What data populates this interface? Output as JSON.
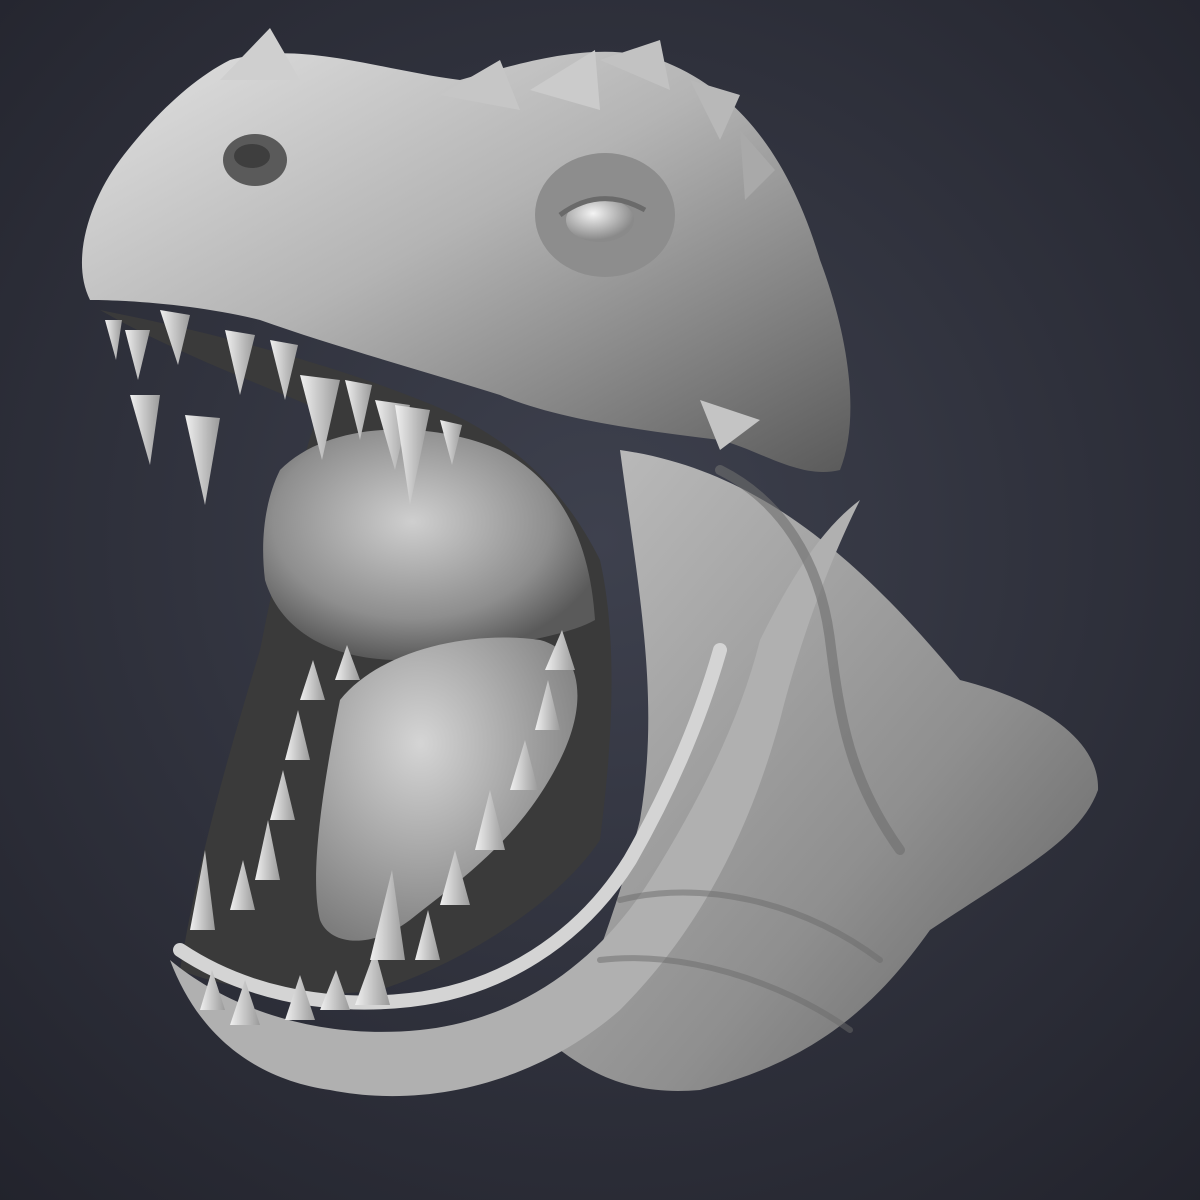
{
  "scene": {
    "subject": "sculpt",
    "material": "matcap-gray",
    "colors": {
      "background_center": "#3e414e",
      "background_edge": "#22232c",
      "clay_light": "#e6e6e6",
      "clay_mid": "#a9a9a9",
      "clay_dark": "#4d4d4d",
      "mouth_shadow": "#3a3a3a",
      "tooth": "#dcdcdc"
    }
  }
}
